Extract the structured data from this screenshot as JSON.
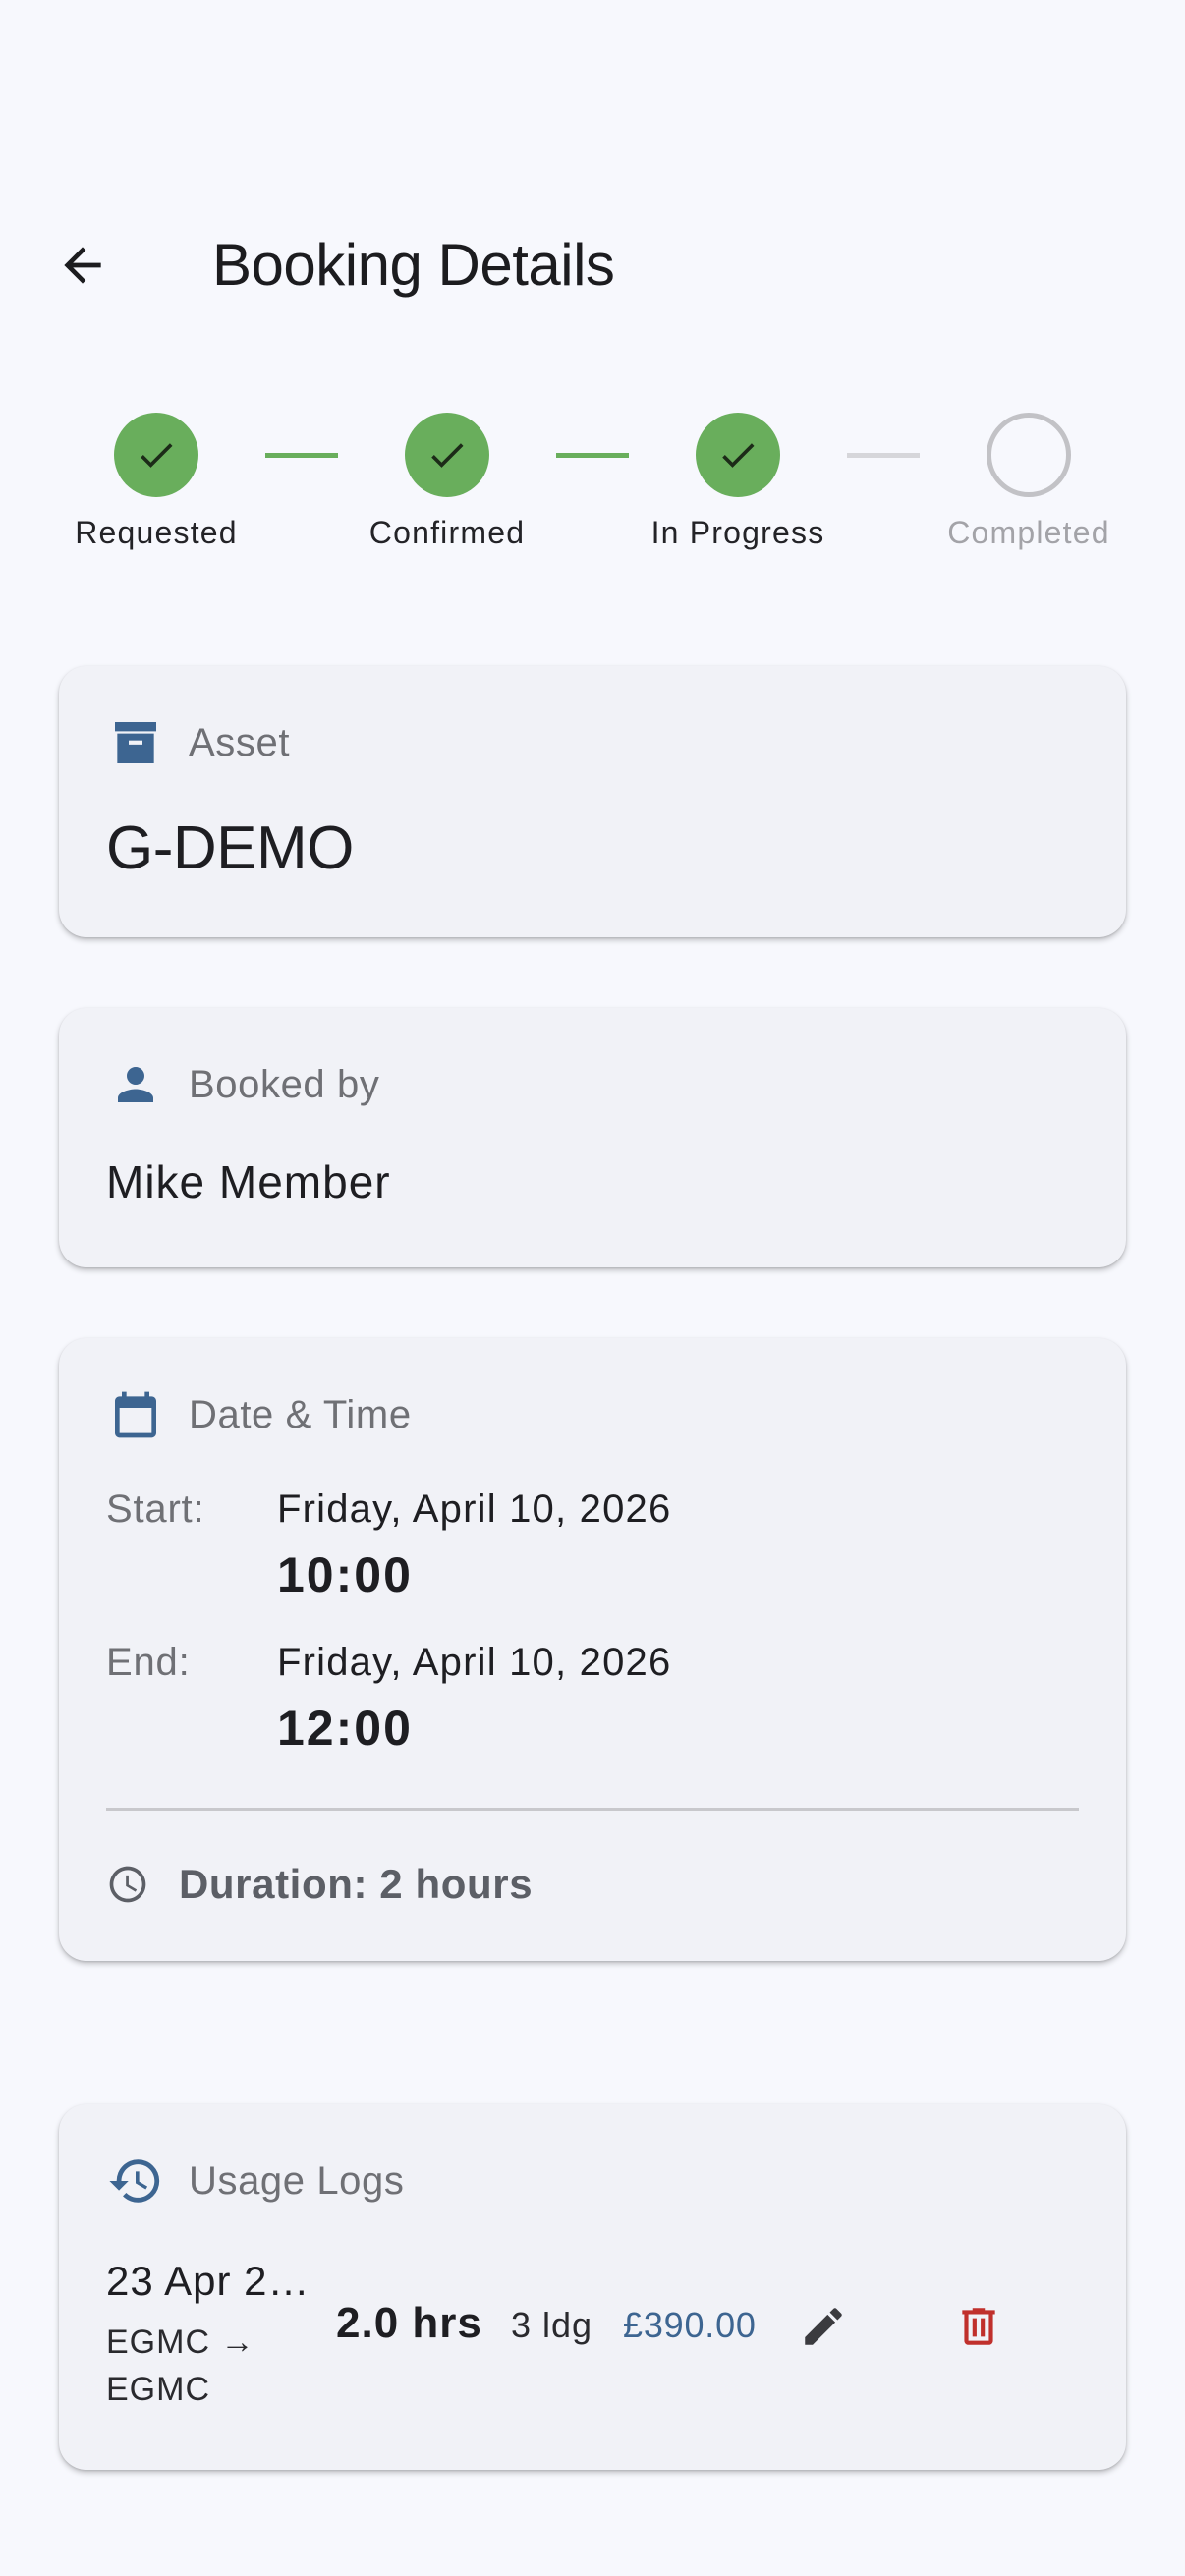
{
  "header": {
    "title": "Booking Details",
    "back_icon": "arrow-left-icon"
  },
  "stepper": {
    "done_color": "#69ae5c",
    "pending_color": "#c2c2c6",
    "steps": [
      {
        "label": "Requested",
        "status": "done"
      },
      {
        "label": "Confirmed",
        "status": "done"
      },
      {
        "label": "In Progress",
        "status": "done"
      },
      {
        "label": "Completed",
        "status": "pending"
      }
    ]
  },
  "asset": {
    "heading": "Asset",
    "icon": "archive-box-icon",
    "value": "G-DEMO"
  },
  "booked_by": {
    "heading": "Booked by",
    "icon": "person-icon",
    "value": "Mike Member"
  },
  "date_time": {
    "heading": "Date & Time",
    "icon": "calendar-icon",
    "start_label": "Start:",
    "start_date": "Friday, April 10, 2026",
    "start_time": "10:00",
    "end_label": "End:",
    "end_date": "Friday, April 10, 2026",
    "end_time": "12:00",
    "duration_icon": "clock-icon",
    "duration": "Duration: 2 hours"
  },
  "usage_logs": {
    "heading": "Usage Logs",
    "icon": "history-icon",
    "entries": [
      {
        "date": "23 Apr 2…",
        "route": "EGMC → EGMC",
        "hours": "2.0 hrs",
        "landings": "3 ldg",
        "amount": "£390.00",
        "edit_icon": "pencil-icon",
        "delete_icon": "trash-icon"
      }
    ]
  },
  "colors": {
    "accent": "#3d6591",
    "delete": "#c0302c",
    "background": "#f7f8fd",
    "card": "#f1f2f7"
  }
}
